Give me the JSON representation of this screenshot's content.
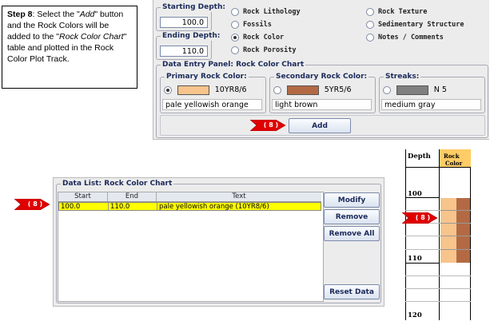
{
  "step": {
    "label": "Step 8",
    "t1": ": Select the \"",
    "add_word": "Add",
    "t2": "\" button and the Rock Colors will be added to the \"",
    "chart_word": "Rock Color Chart",
    "t3": "\" table and plotted in the Rock Color Plot Track."
  },
  "depth": {
    "starting_label": "Starting Depth:",
    "starting_value": "100.0",
    "ending_label": "Ending Depth:",
    "ending_value": "110.0"
  },
  "options": [
    {
      "label": "Rock Lithology",
      "selected": false
    },
    {
      "label": "Fossils",
      "selected": false
    },
    {
      "label": "Rock Color",
      "selected": true
    },
    {
      "label": "Rock Porosity",
      "selected": false
    },
    {
      "label": "Rock Texture",
      "selected": false
    },
    {
      "label": "Sedimentary Structure",
      "selected": false
    },
    {
      "label": "Notes / Comments",
      "selected": false
    }
  ],
  "entry_panel": {
    "title": "Data Entry Panel: Rock Color Chart",
    "primary": {
      "title": "Primary Rock Color:",
      "code": "10YR8/6",
      "name": "pale yellowish orange",
      "color": "#f7c48c"
    },
    "secondary": {
      "title": "Secondary Rock Color:",
      "code": "5YR5/6",
      "name": "light brown",
      "color": "#b36a44"
    },
    "streaks": {
      "title": "Streaks:",
      "code": "N 5",
      "name": "medium gray",
      "color": "#808080"
    },
    "add_label": "Add"
  },
  "markers": {
    "label": "( 8 )"
  },
  "data_list": {
    "title": "Data List: Rock Color Chart",
    "columns": [
      "Start",
      "End",
      "Text"
    ],
    "rows": [
      {
        "start": "100.0",
        "end": "110.0",
        "text": "pale yellowish orange (10YR8/6)"
      }
    ],
    "modify_label": "Modify",
    "remove_label": "Remove",
    "remove_all_label": "Remove All",
    "reset_label": "Reset Data"
  },
  "track": {
    "depth_header": "Depth",
    "track_header_1": "Rock",
    "track_header_2": "Color",
    "depth_100": "100",
    "depth_110": "110",
    "depth_120": "120",
    "primary_color": "#f7c48c",
    "secondary_color": "#b36a44",
    "header_color": "#ffcc66"
  }
}
